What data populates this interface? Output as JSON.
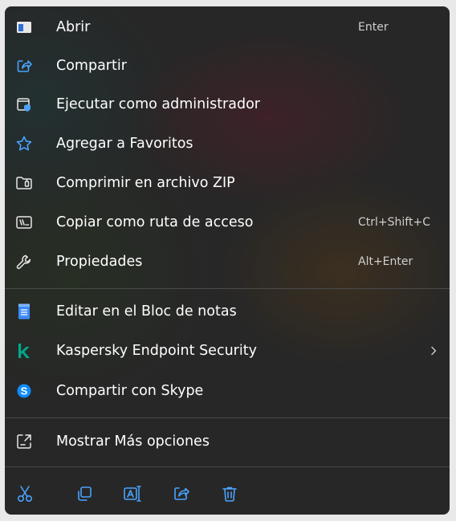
{
  "menu": {
    "items": [
      {
        "label": "Abrir",
        "shortcut": "Enter",
        "icon": "window-icon"
      },
      {
        "label": "Compartir",
        "icon": "share-icon"
      },
      {
        "label": "Ejecutar como administrador",
        "icon": "shield-admin-icon"
      },
      {
        "label": "Agregar a Favoritos",
        "icon": "star-icon"
      },
      {
        "label": "Comprimir en archivo ZIP",
        "icon": "zip-folder-icon"
      },
      {
        "label": "Copiar como ruta de acceso",
        "shortcut": "Ctrl+Shift+C",
        "icon": "path-copy-icon"
      },
      {
        "label": "Propiedades",
        "shortcut": "Alt+Enter",
        "icon": "wrench-icon"
      }
    ],
    "apps": [
      {
        "label": "Editar en el Bloc de notas",
        "icon": "notepad-icon"
      },
      {
        "label": "Kaspersky Endpoint Security",
        "icon": "kaspersky-icon",
        "submenu": true
      },
      {
        "label": "Compartir con Skype",
        "icon": "skype-icon"
      }
    ],
    "more": {
      "label": "Mostrar Más opciones",
      "icon": "more-options-icon"
    },
    "actions": [
      "cut-icon",
      "copy-icon",
      "rename-icon",
      "share-icon",
      "delete-icon"
    ]
  },
  "colors": {
    "accent": "#4aa3ff",
    "kaspersky": "#00a88e",
    "skype": "#0f8cff",
    "text": "#ffffff",
    "muted": "#cfcfcf"
  }
}
